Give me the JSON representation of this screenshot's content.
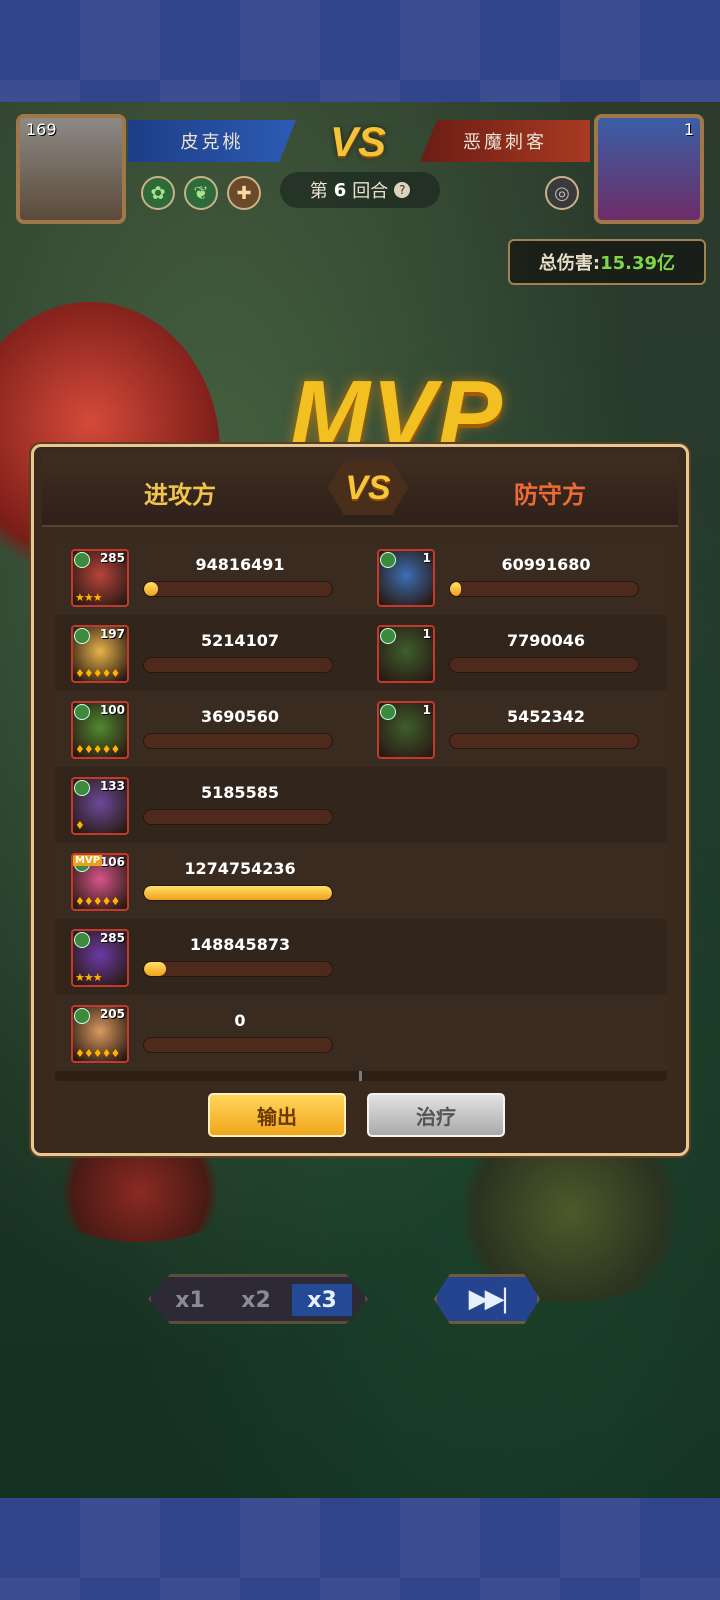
{
  "header": {
    "player_left": {
      "level": "169",
      "name": "皮克桃"
    },
    "player_right": {
      "level": "1",
      "name": "恶魔刺客"
    },
    "vs": "VS",
    "round": {
      "prefix": "第",
      "number": "6",
      "suffix": "回合",
      "help": "?"
    },
    "total_damage": {
      "label": "总伤害:",
      "value": "15.39亿"
    }
  },
  "mvp_label": "MVP",
  "panel": {
    "attacker_title": "进攻方",
    "defender_title": "防守方",
    "vs": "VS",
    "attackers": [
      {
        "level": "285",
        "damage": "94816491",
        "fill": 0.074,
        "stars": "★★★",
        "portrait": "#b8443a"
      },
      {
        "level": "197",
        "damage": "5214107",
        "fill": 0.0,
        "stars": "♦♦♦♦♦",
        "portrait": "#e7b34a"
      },
      {
        "level": "100",
        "damage": "3690560",
        "fill": 0.0,
        "stars": "♦♦♦♦♦",
        "portrait": "#4f8a2f"
      },
      {
        "level": "133",
        "damage": "5185585",
        "fill": 0.0,
        "stars": "♦",
        "portrait": "#6b4a9b"
      },
      {
        "level": "106",
        "damage": "1274754236",
        "fill": 1.0,
        "stars": "♦♦♦♦♦",
        "portrait": "#d7568a",
        "mvp": "MVP"
      },
      {
        "level": "285",
        "damage": "148845873",
        "fill": 0.117,
        "stars": "★★★",
        "portrait": "#6a3aa6"
      },
      {
        "level": "205",
        "damage": "0",
        "fill": 0.0,
        "stars": "♦♦♦♦♦",
        "portrait": "#d99a5e"
      }
    ],
    "defenders": [
      {
        "level": "1",
        "damage": "60991680",
        "fill": 0.048,
        "portrait": "#3a6fb3"
      },
      {
        "level": "1",
        "damage": "7790046",
        "fill": 0.0,
        "portrait": "#3d5f2c"
      },
      {
        "level": "1",
        "damage": "5452342",
        "fill": 0.0,
        "portrait": "#3d5f2c"
      }
    ],
    "tabs": {
      "output": "输出",
      "heal": "治疗"
    }
  },
  "controls": {
    "speeds": [
      "x1",
      "x2",
      "x3"
    ],
    "active_speed": "x3",
    "skip": "▶▶|"
  },
  "colors": {
    "accent_gold": "#f3c44b",
    "defender_red": "#f06a35",
    "damage_green": "#7fd64a"
  }
}
